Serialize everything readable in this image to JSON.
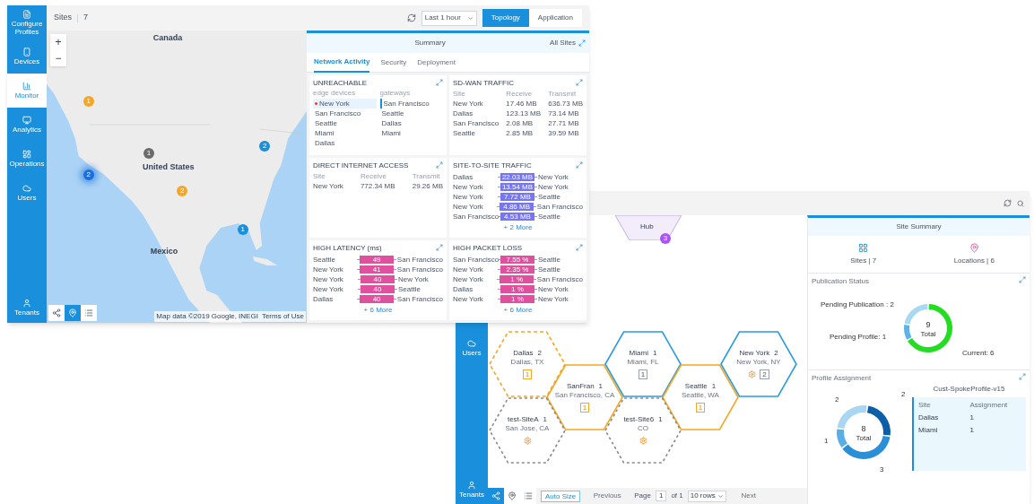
{
  "overview": {
    "sidebar": {
      "items": [
        {
          "label": "Configure Profiles",
          "selected": false
        },
        {
          "label": "Devices",
          "selected": false
        },
        {
          "label": "Monitor",
          "selected": true
        },
        {
          "label": "Analytics",
          "selected": false
        },
        {
          "label": "Operations",
          "selected": false
        },
        {
          "label": "Users",
          "selected": false
        }
      ],
      "footer": "Tenants"
    },
    "header": {
      "title": "Sites",
      "count": "7",
      "range": "Last 1 hour",
      "views": [
        {
          "label": "Topology",
          "selected": true
        },
        {
          "label": "Application",
          "selected": false
        }
      ]
    },
    "map": {
      "zoom": [
        "+",
        "−"
      ],
      "labels": [
        "Canada",
        "United States",
        "Mexico"
      ],
      "pins": [
        {
          "kind": "pin",
          "number": "1",
          "color": "#f5a623"
        },
        {
          "kind": "pin",
          "number": "2",
          "color": "#1a8fdb"
        },
        {
          "kind": "pin",
          "number": "1",
          "color": "#6b6b6b"
        },
        {
          "kind": "cluster",
          "number": "2",
          "color": "#1a6fe0"
        },
        {
          "kind": "pin",
          "number": "2",
          "color": "#f5a623"
        },
        {
          "kind": "pin",
          "number": "1",
          "color": "#1a8fdb"
        }
      ],
      "attribution": "Map data ©2019 Google, INEGI",
      "terms": "Terms of Use",
      "views": [
        {
          "kind": "topology",
          "selected": false
        },
        {
          "kind": "map",
          "selected": true
        },
        {
          "kind": "list",
          "selected": false
        }
      ]
    },
    "summary": {
      "title": "Summary",
      "scope": "All Sites",
      "tabs": [
        {
          "label": "Network Activity",
          "selected": true
        },
        {
          "label": "Security",
          "selected": false
        },
        {
          "label": "Deployment",
          "selected": false
        }
      ],
      "cards": [
        {
          "kind": "split",
          "title": "UNREACHABLE",
          "columns": [
            {
              "heading": "edge devices",
              "items": [
                {
                  "label": "New York",
                  "selected": true
                },
                {
                  "label": "San Francisco",
                  "selected": false
                },
                {
                  "label": "Seattle",
                  "selected": false
                },
                {
                  "label": "Miami",
                  "selected": false
                },
                {
                  "label": "Dallas",
                  "selected": false
                }
              ]
            },
            {
              "heading": "gateways",
              "items": [
                {
                  "label": "San Francisco",
                  "selected": true
                },
                {
                  "label": "Seattle",
                  "selected": false
                },
                {
                  "label": "Dallas",
                  "selected": false
                },
                {
                  "label": "Miami",
                  "selected": false
                }
              ]
            }
          ]
        },
        {
          "kind": "table",
          "title": "SD-WAN TRAFFIC",
          "columns": [
            "Site",
            "Receive",
            "Transmit"
          ],
          "rows": [
            [
              "New York",
              "17.46 MB",
              "636.73 MB"
            ],
            [
              "Dallas",
              "123.13 MB",
              "73.14 MB"
            ],
            [
              "San Francisco",
              "2.08 MB",
              "27.71 MB"
            ],
            [
              "Seattle",
              "2.85 MB",
              "39.59 MB"
            ]
          ]
        },
        {
          "kind": "table",
          "title": "DIRECT INTERNET ACCESS",
          "columns": [
            "Site",
            "Receive",
            "Transmit"
          ],
          "rows": [
            [
              "New York",
              "772.34 MB",
              "29.26 MB"
            ]
          ]
        },
        {
          "kind": "pairs",
          "title": "SITE-TO-SITE TRAFFIC",
          "color": "#7676f2",
          "rows": [
            {
              "from": "Dallas",
              "value": "22.03 MB",
              "to": "New York"
            },
            {
              "from": "New York",
              "value": "13.54 MB",
              "to": "New York"
            },
            {
              "from": "New York",
              "value": "7.72 MB",
              "to": "Seattle"
            },
            {
              "from": "New York",
              "value": "4.86 MB",
              "to": "San Francisco"
            },
            {
              "from": "San Francisco",
              "value": "4.53 MB",
              "to": "Seattle"
            }
          ],
          "more": "+ 2 More"
        },
        {
          "kind": "pairs",
          "title": "HIGH LATENCY (ms)",
          "color": "#e0509f",
          "rows": [
            {
              "from": "Seattle",
              "value": "49",
              "to": "San Francisco"
            },
            {
              "from": "New York",
              "value": "41",
              "to": "San Francisco"
            },
            {
              "from": "New York",
              "value": "40",
              "to": "New York"
            },
            {
              "from": "New York",
              "value": "40",
              "to": "Seattle"
            },
            {
              "from": "Dallas",
              "value": "40",
              "to": "San Francisco"
            }
          ],
          "more": "+ 6 More"
        },
        {
          "kind": "pairs",
          "title": "HIGH PACKET LOSS",
          "color": "#e0509f",
          "rows": [
            {
              "from": "San Francisco",
              "value": "7.55 %",
              "to": "Seattle"
            },
            {
              "from": "New York",
              "value": "2.35 %",
              "to": "Seattle"
            },
            {
              "from": "New York",
              "value": "1 %",
              "to": "San Francisco"
            },
            {
              "from": "Dallas",
              "value": "1 %",
              "to": "New York"
            },
            {
              "from": "New York",
              "value": "1 %",
              "to": "New York"
            }
          ],
          "more": "+ 6 More"
        }
      ]
    }
  },
  "sites": {
    "sidebar": {
      "items": [
        {
          "label": "Users"
        }
      ],
      "footer": "Tenants"
    },
    "hub": {
      "label": "Hub",
      "badge": "3"
    },
    "nodes": [
      {
        "name": "Dallas",
        "count": "2",
        "location": "Dallas, TX",
        "kind": "draft",
        "badge": "1",
        "gear": false
      },
      {
        "name": "SanFran",
        "count": "1",
        "location": "San Francisco, CA",
        "kind": "pending",
        "badge": "1",
        "gear": false
      },
      {
        "name": "Miami",
        "count": "1",
        "location": "Miami, FL",
        "kind": "current",
        "badge": "1",
        "gear": false
      },
      {
        "name": "Seattle",
        "count": "1",
        "location": "Seattle, WA",
        "kind": "pending",
        "badge": "1",
        "gear": false
      },
      {
        "name": "New York",
        "count": "2",
        "location": "New York, NY",
        "kind": "current",
        "badge": "2",
        "gear": true
      },
      {
        "name": "test-SiteA",
        "count": "1",
        "location": "San Jose, CA",
        "kind": "inactive",
        "gear": true
      },
      {
        "name": "test-Site6",
        "count": "1",
        "location": "CO",
        "kind": "inactive",
        "gear": true
      }
    ],
    "pager": {
      "views": [
        {
          "kind": "topology",
          "selected": true
        },
        {
          "kind": "map",
          "selected": false
        },
        {
          "kind": "list",
          "selected": false
        }
      ],
      "fit": "Auto Size",
      "previous": {
        "label": "Previous",
        "disabled": true
      },
      "page_label": "Page",
      "page": "1",
      "of": "of 1",
      "rows": "10 rows",
      "next": {
        "label": "Next",
        "disabled": true
      }
    },
    "panel": {
      "title": "Site Summary",
      "stats": [
        "Sites | 7",
        "Locations | 6"
      ],
      "publication": {
        "title": "Publication Status",
        "total": "9",
        "total_label": "Total",
        "chart_data": {
          "type": "donut",
          "values": [
            6,
            1,
            2
          ],
          "value_labels": [
            "Current: 6",
            "Pending Profile: 1",
            "Pending Publication : 2"
          ]
        }
      },
      "assignment": {
        "title": "Profile Assignment",
        "total": "8",
        "total_label": "Total",
        "chart_data": {
          "type": "donut",
          "values": [
            2,
            3,
            1,
            2
          ],
          "value_labels": [
            "2",
            "3",
            "1",
            "2"
          ]
        },
        "table": {
          "title": "Cust-SpokeProfile-v15",
          "columns": [
            "Site",
            "Assignment"
          ],
          "rows": [
            [
              "Dallas",
              "1"
            ],
            [
              "Miami",
              "1"
            ]
          ]
        }
      }
    }
  }
}
